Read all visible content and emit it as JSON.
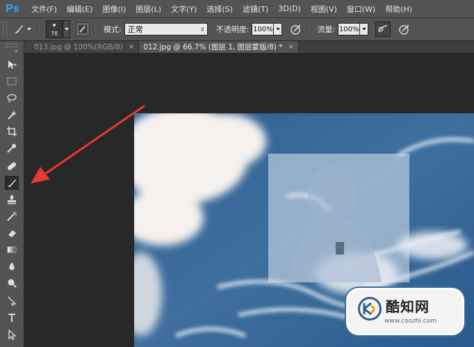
{
  "app": {
    "logo": "Ps",
    "accent": "#31a8ff"
  },
  "menu": [
    "文件(F)",
    "编辑(E)",
    "图像(I)",
    "图层(L)",
    "文字(Y)",
    "选择(S)",
    "滤镜(T)",
    "3D(D)",
    "视图(V)",
    "窗口(W)",
    "帮助(H)"
  ],
  "options": {
    "brush_size": "78",
    "mode_label": "模式:",
    "mode_value": "正常",
    "opacity_label": "不透明度:",
    "opacity_value": "100%",
    "flow_label": "流量:",
    "flow_value": "100%"
  },
  "tabs": [
    {
      "label": "013.jpg @ 100%(RGB/8)",
      "close": "×",
      "active": false
    },
    {
      "label": "012.jpg @ 66.7% (图层 1, 图层蒙版/8) *",
      "close": "×",
      "active": true
    }
  ],
  "tools": [
    "move-icon",
    "marquee-icon",
    "lasso-icon",
    "magic-wand-icon",
    "crop-icon",
    "eyedropper-icon",
    "healing-brush-icon",
    "brush-icon",
    "clone-stamp-icon",
    "history-brush-icon",
    "eraser-icon",
    "gradient-icon",
    "blur-icon",
    "dodge-icon",
    "path-selection-icon",
    "type-icon",
    "direct-selection-icon"
  ],
  "active_tool": "brush-icon",
  "watermark": {
    "title": "酷知网",
    "url": "www.coozhi.com"
  },
  "colors": {
    "sky": "#3f6f9e",
    "arrow": "#e53935"
  }
}
